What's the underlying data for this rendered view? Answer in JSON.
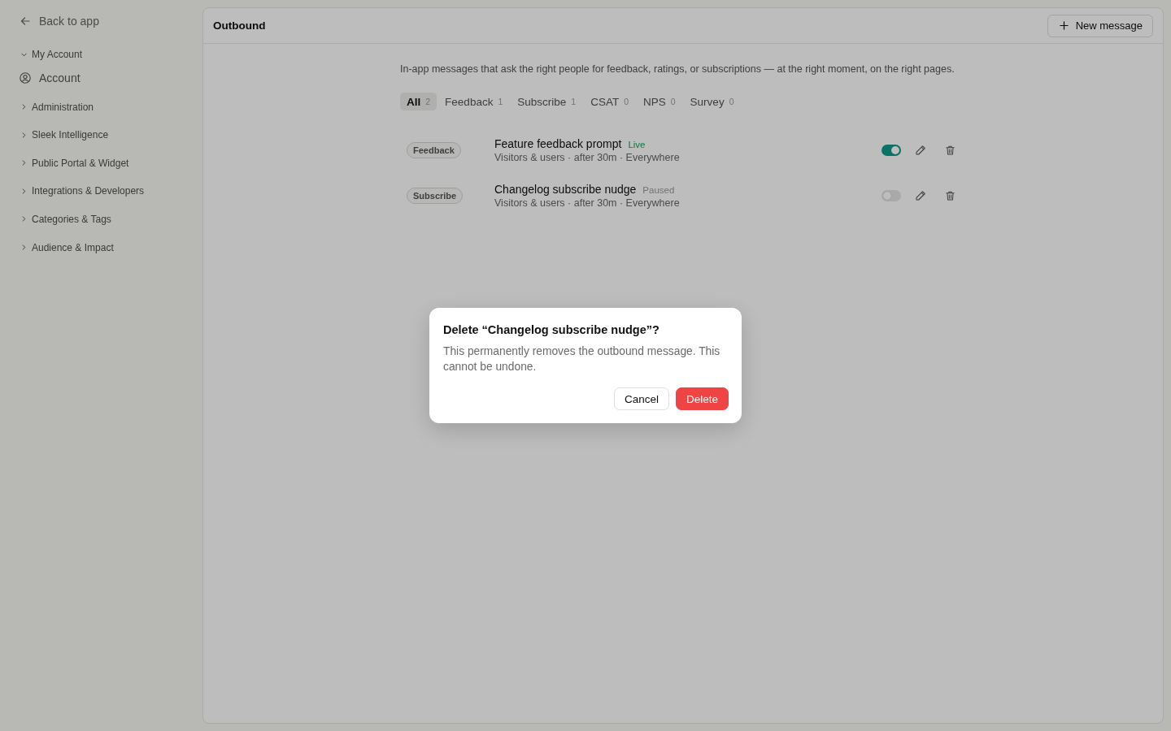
{
  "sidebar": {
    "back_link": "Back to app",
    "groups": [
      {
        "label": "My Account",
        "expanded": true,
        "items": [
          {
            "label": "Account"
          }
        ]
      },
      {
        "label": "Administration",
        "expanded": false
      },
      {
        "label": "Sleek Intelligence",
        "expanded": false
      },
      {
        "label": "Public Portal & Widget",
        "expanded": false
      },
      {
        "label": "Integrations & Developers",
        "expanded": false
      },
      {
        "label": "Categories & Tags",
        "expanded": false
      },
      {
        "label": "Audience & Impact",
        "expanded": false
      }
    ]
  },
  "main": {
    "title": "Outbound",
    "new_button": "New message",
    "description": "In-app messages that ask the right people for feedback, ratings, or subscriptions — at the right moment, on the right pages.",
    "tabs": [
      {
        "label": "All",
        "count": "2",
        "selected": true
      },
      {
        "label": "Feedback",
        "count": "1",
        "selected": false
      },
      {
        "label": "Subscribe",
        "count": "1",
        "selected": false
      },
      {
        "label": "CSAT",
        "count": "0",
        "selected": false
      },
      {
        "label": "NPS",
        "count": "0",
        "selected": false
      },
      {
        "label": "Survey",
        "count": "0",
        "selected": false
      }
    ],
    "messages": [
      {
        "type": "Feedback",
        "title": "Feature feedback prompt",
        "status": "Live",
        "details": "Visitors & users · after 30m · Everywhere",
        "on": true
      },
      {
        "type": "Subscribe",
        "title": "Changelog subscribe nudge",
        "status": "Paused",
        "details": "Visitors & users · after 30m · Everywhere",
        "on": false
      }
    ]
  },
  "dialog": {
    "title": "Delete “Changelog subscribe nudge”?",
    "message": "This permanently removes the outbound message. This cannot be undone.",
    "buttons": [
      {
        "label": "Cancel",
        "kind": "secondary"
      },
      {
        "label": "Delete",
        "kind": "danger"
      }
    ]
  }
}
